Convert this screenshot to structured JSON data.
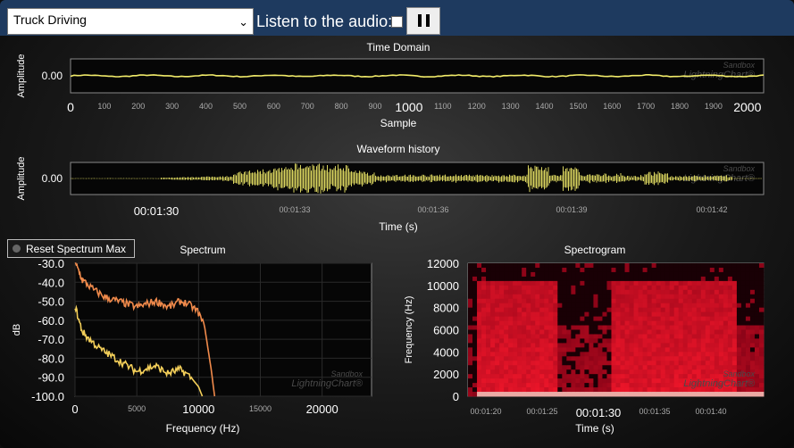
{
  "toolbar": {
    "selected_sound": "Truck Driving",
    "listen_label": "Listen to the audio:",
    "listen_checked": false,
    "pause_icon": "pause-icon"
  },
  "reset_button_label": "Reset Spectrum Max",
  "watermark": {
    "line1": "Sandbox",
    "line2": "LightningChart®"
  },
  "colors": {
    "signal": "#f2ec6a",
    "spectrum_max": "#f08a4b",
    "spectrum_now": "#f5d05a",
    "topbar": "#1e3a5f"
  },
  "chart_data": [
    {
      "type": "line",
      "title": "Time Domain",
      "xlabel": "Sample",
      "ylabel": "Amplitude",
      "x_ticks": [
        0,
        100,
        200,
        300,
        400,
        500,
        600,
        700,
        800,
        900,
        1000,
        1100,
        1200,
        1300,
        1400,
        1500,
        1600,
        1700,
        1800,
        1900,
        2000
      ],
      "x_major": [
        0,
        1000,
        2000
      ],
      "xlim": [
        0,
        2048
      ],
      "y_ticks": [
        "0.00"
      ],
      "ylim": [
        -1,
        1
      ],
      "series": [
        {
          "values": [
            0.0
          ]
        }
      ]
    },
    {
      "type": "line",
      "title": "Waveform history",
      "xlabel": "Time (s)",
      "ylabel": "Amplitude",
      "x_ticks": [
        "00:01:30",
        "00:01:33",
        "00:01:36",
        "00:01:39",
        "00:01:42"
      ],
      "x_major": [
        "00:01:30"
      ],
      "xlim": [
        89.5,
        143.5
      ],
      "y_ticks": [
        "0.00"
      ],
      "ylim": [
        -1,
        1
      ]
    },
    {
      "type": "line",
      "title": "Spectrum",
      "xlabel": "Frequency (Hz)",
      "ylabel": "dB",
      "x_ticks": [
        0,
        5000,
        10000,
        15000,
        20000
      ],
      "x_major": [
        0,
        10000,
        20000
      ],
      "xlim": [
        0,
        24000
      ],
      "y_ticks": [
        -30.0,
        -40.0,
        -50.0,
        -60.0,
        -70.0,
        -80.0,
        -90.0,
        -100.0
      ],
      "ylim": [
        -100,
        -30
      ],
      "series": [
        {
          "x": [
            0,
            300,
            600,
            1000,
            1500,
            2000,
            2500,
            3000,
            3500,
            4000,
            4500,
            5000,
            5500,
            6000,
            6500,
            7000,
            7500,
            8000,
            8500,
            9000,
            9500,
            10000,
            10500,
            11000,
            11300
          ],
          "values": [
            -30,
            -34,
            -39,
            -41,
            -44,
            -46,
            -48,
            -49,
            -50,
            -51,
            -52,
            -53,
            -52,
            -51,
            -50,
            -51,
            -53,
            -52,
            -50,
            -51,
            -53,
            -56,
            -64,
            -85,
            -100
          ]
        },
        {
          "x": [
            0,
            300,
            600,
            1000,
            1500,
            2000,
            2500,
            3000,
            3500,
            4000,
            4500,
            5000,
            5500,
            6000,
            6500,
            7000,
            7500,
            8000,
            8500,
            9000,
            9500,
            10000,
            10300
          ],
          "values": [
            -52,
            -60,
            -66,
            -69,
            -72,
            -75,
            -77,
            -79,
            -81,
            -83,
            -85,
            -87,
            -86,
            -85,
            -84,
            -86,
            -88,
            -87,
            -86,
            -88,
            -91,
            -95,
            -100
          ]
        }
      ]
    },
    {
      "type": "heatmap",
      "title": "Spectrogram",
      "xlabel": "Time (s)",
      "ylabel": "Frequency (Hz)",
      "x_ticks": [
        "00:01:20",
        "00:01:25",
        "00:01:30",
        "00:01:35",
        "00:01:40"
      ],
      "x_major": [
        "00:01:30"
      ],
      "y_ticks": [
        0,
        2000,
        4000,
        6000,
        8000,
        10000,
        12000
      ],
      "ylim": [
        0,
        12000
      ]
    }
  ]
}
